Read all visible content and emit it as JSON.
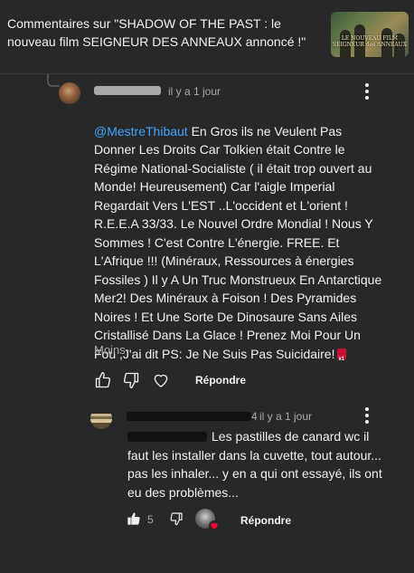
{
  "header": {
    "title": "Commentaires sur \"SHADOW OF THE PAST : le nouveau film SEIGNEUR DES ANNEAUX annoncé !\"",
    "thumbnail_text": "LE NOUVEAU FILM SEIGNEUR des ANNEAUX"
  },
  "comment1": {
    "time": "il y a 1 jour",
    "mention": "@MestreThibaut",
    "text": " En Gros ils ne Veulent Pas Donner Les Droits Car Tolkien était Contre le Régime National-Socialiste ( il était trop ouvert au Monde! Heureusement) Car l'aigle Imperial Regardait Vers L'EST ..L'occident et L'orient ! R.E.E.A  33/33. Le Nouvel Ordre Mondial ! Nous Y Sommes ! C'est Contre L'énergie. FREE. Et L'Afrique !!! (Minéraux, Ressources à énergies Fossiles ) Il y A Un Truc Monstrueux En Antarctique Mer2! Des Minéraux à Foison ! Des Pyramides Noires ! Et Une Sorte De Dinosaure  Sans Ailes Cristallisé Dans La Glace ! Prenez Moi Pour Un Fou ,J'ai dit PS: Je Ne Suis Pas Suicidaire!",
    "less_label": "Moins",
    "reply_label": "Répondre",
    "icons": {
      "like": "thumb-up-icon",
      "dislike": "thumb-down-icon",
      "heart": "heart-icon",
      "menu": "more-vert-icon"
    }
  },
  "comment2": {
    "author_suffix": "4",
    "time": "il y a 1 jour",
    "text": "Les pastilles de canard wc il faut les installer dans la cuvette, tout autour... pas les inhaler... y en a qui ont essayé, ils ont eu des problèmes...",
    "likes": "5",
    "reply_label": "Répondre",
    "icons": {
      "like": "thumb-up-icon",
      "dislike": "thumb-down-icon",
      "creator_heart": "creator-heart-icon",
      "menu": "more-vert-icon"
    }
  },
  "colors": {
    "background": "#282828",
    "mention": "#3ea6ff",
    "secondary_text": "#aaaaaa",
    "heart": "#ff0033"
  }
}
